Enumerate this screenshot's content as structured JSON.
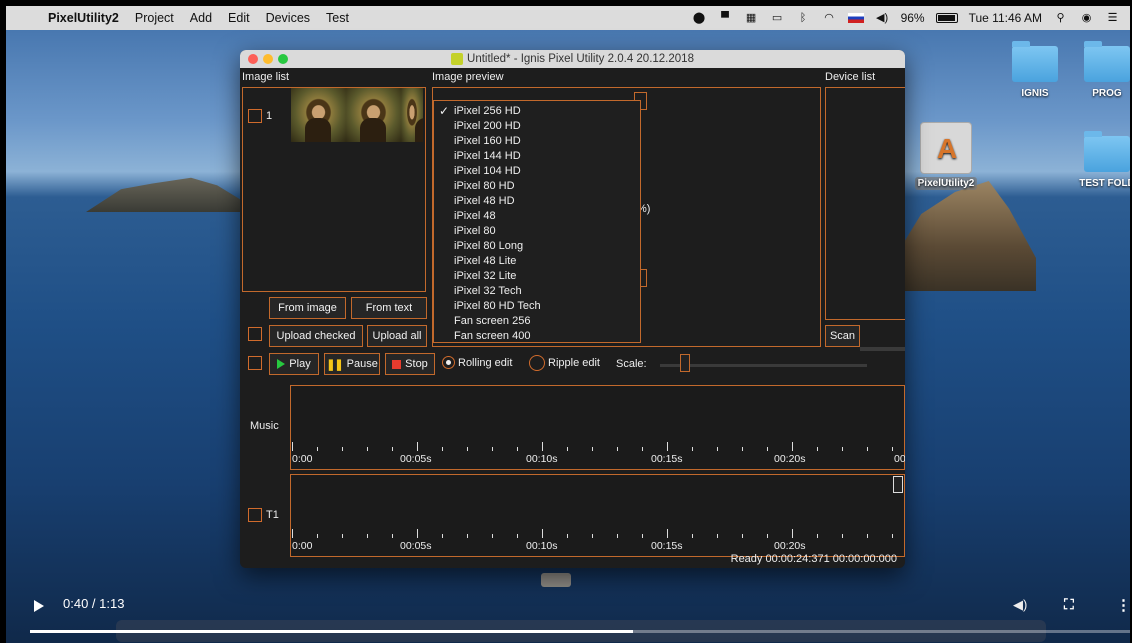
{
  "menubar": {
    "app_name": "PixelUtility2",
    "items": [
      "Project",
      "Add",
      "Edit",
      "Devices",
      "Test"
    ],
    "battery": "96%",
    "clock": "Tue 11:46 AM"
  },
  "desktop": {
    "icons": [
      {
        "label": "IGNIS",
        "icon": "folder-icon"
      },
      {
        "label": "PROG",
        "icon": "folder-icon"
      },
      {
        "label": "PixelUtility2",
        "icon": "app-icon"
      },
      {
        "label": "TEST FOLD",
        "icon": "folder-icon"
      }
    ]
  },
  "window": {
    "title": "Untitled* - Ignis Pixel Utility 2.0.4 20.12.2018",
    "image_list_label": "Image list",
    "image_preview_label": "Image preview",
    "device_list_label": "Device list",
    "image_row_number": "1",
    "preview_fragment": "%)",
    "buttons": {
      "from_image": "From image",
      "from_text": "From text",
      "upload_checked": "Upload checked",
      "upload_all": "Upload all",
      "scan": "Scan",
      "play": "Play",
      "pause": "Pause",
      "stop": "Stop"
    },
    "radios": {
      "rolling_edit": "Rolling edit",
      "ripple_edit": "Ripple edit",
      "selected": "rolling_edit"
    },
    "scale_label": "Scale:",
    "device_dropdown": {
      "selected": "iPixel 256 HD",
      "options": [
        "iPixel 256 HD",
        "iPixel 200 HD",
        "iPixel 160 HD",
        "iPixel 144 HD",
        "iPixel 104 HD",
        "iPixel 80 HD",
        "iPixel 48 HD",
        "iPixel 48",
        "iPixel 80",
        "iPixel 80 Long",
        "iPixel 48 Lite",
        "iPixel 32 Lite",
        "iPixel 32 Tech",
        "iPixel 80 HD Tech",
        "Fan screen 256",
        "Fan screen 400"
      ]
    },
    "timeline": {
      "music_label": "Music",
      "track_label": "T1",
      "music_time_labels": [
        "0:00",
        "00:05s",
        "00:10s",
        "00:15s",
        "00:20s",
        "00"
      ],
      "track_time_labels": [
        "0:00",
        "00:05s",
        "00:10s",
        "00:15s",
        "00:20s"
      ]
    },
    "status": "Ready  00:00:24:371  00:00:00:000"
  },
  "video": {
    "time": "0:40 / 1:13",
    "progress_fraction": 0.548
  },
  "colors": {
    "accent": "#c2692c",
    "window_bg": "#1d1d1d",
    "play": "#27c93f",
    "pause": "#f5c518",
    "stop": "#e63b2e"
  }
}
